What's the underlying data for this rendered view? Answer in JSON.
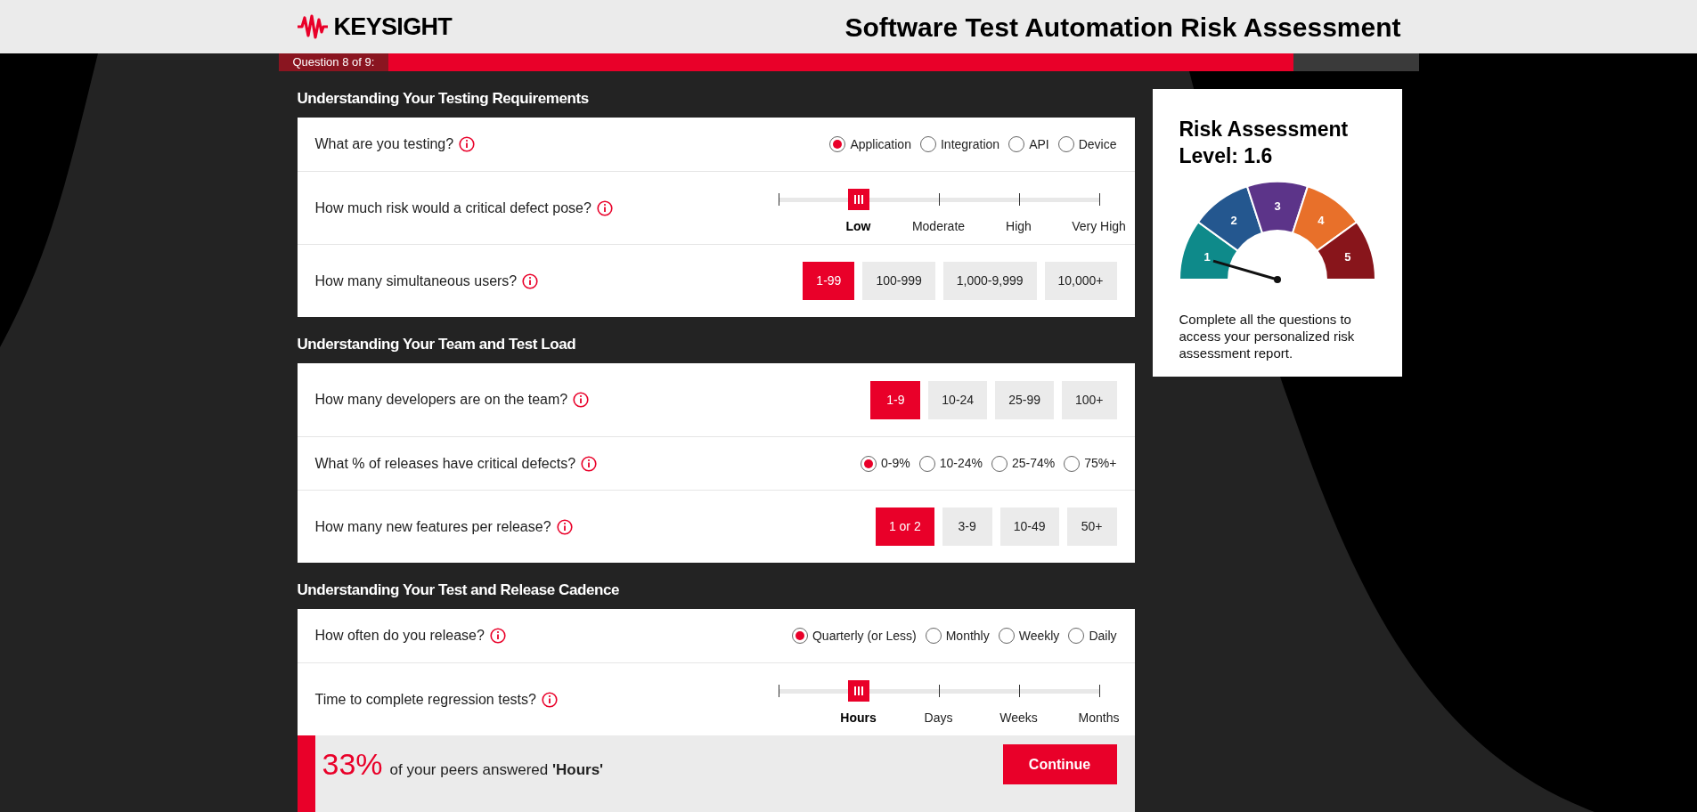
{
  "header": {
    "logo": "KEYSIGHT",
    "title": "Software Test Automation Risk Assessment"
  },
  "progress": {
    "label": "Question 8 of 9:",
    "level": 0.89
  },
  "sections": [
    {
      "title": "Understanding Your Testing Requirements",
      "questions": [
        {
          "kind": "radio",
          "text": "What are you testing?",
          "options": [
            {
              "label": "Application",
              "selected": true
            },
            {
              "label": "Integration",
              "selected": false
            },
            {
              "label": "API",
              "selected": false
            },
            {
              "label": "Device",
              "selected": false
            }
          ]
        },
        {
          "kind": "slider",
          "text": "How much risk would a critical defect pose?",
          "level": 0.25,
          "options": [
            {
              "label": "Low",
              "selected": true
            },
            {
              "label": "Moderate",
              "selected": false
            },
            {
              "label": "High",
              "selected": false
            },
            {
              "label": "Very High",
              "selected": false
            }
          ]
        },
        {
          "kind": "buttons",
          "text": "How many simultaneous users?",
          "options": [
            {
              "label": "1-99",
              "selected": true
            },
            {
              "label": "100-999",
              "selected": false
            },
            {
              "label": "1,000-9,999",
              "selected": false
            },
            {
              "label": "10,000+",
              "selected": false
            }
          ]
        }
      ]
    },
    {
      "title": "Understanding Your Team and Test Load",
      "questions": [
        {
          "kind": "buttons",
          "text": "How many developers are on the team?",
          "options": [
            {
              "label": "1-9",
              "selected": true
            },
            {
              "label": "10-24",
              "selected": false
            },
            {
              "label": "25-99",
              "selected": false
            },
            {
              "label": "100+",
              "selected": false
            }
          ]
        },
        {
          "kind": "radio",
          "text": "What % of releases have critical defects?",
          "options": [
            {
              "label": "0-9%",
              "selected": true
            },
            {
              "label": "10-24%",
              "selected": false
            },
            {
              "label": "25-74%",
              "selected": false
            },
            {
              "label": "75%+",
              "selected": false
            }
          ]
        },
        {
          "kind": "buttons",
          "text": "How many new features per release?",
          "options": [
            {
              "label": "1 or 2",
              "selected": true
            },
            {
              "label": "3-9",
              "selected": false
            },
            {
              "label": "10-49",
              "selected": false
            },
            {
              "label": "50+",
              "selected": false
            }
          ]
        }
      ]
    },
    {
      "title": "Understanding Your Test and Release Cadence",
      "questions": [
        {
          "kind": "radio",
          "text": "How often do you release?",
          "options": [
            {
              "label": "Quarterly (or Less)",
              "selected": true
            },
            {
              "label": "Monthly",
              "selected": false
            },
            {
              "label": "Weekly",
              "selected": false
            },
            {
              "label": "Daily",
              "selected": false
            }
          ]
        },
        {
          "kind": "slider",
          "text": "Time to complete regression tests?",
          "level": 0.25,
          "options": [
            {
              "label": "Hours",
              "selected": true
            },
            {
              "label": "Days",
              "selected": false
            },
            {
              "label": "Weeks",
              "selected": false
            },
            {
              "label": "Months",
              "selected": false
            }
          ]
        }
      ],
      "peer": {
        "percent": "33%",
        "text": "of your peers answered **'Hours'**",
        "button": "Continue"
      }
    }
  ],
  "risk_card": {
    "title": "Risk Assessment Level: 1.6",
    "segments": [
      {
        "label": "1",
        "color": "#0e8a8a"
      },
      {
        "label": "2",
        "color": "#24578f"
      },
      {
        "label": "3",
        "color": "#5c3489"
      },
      {
        "label": "4",
        "color": "#e8702a"
      },
      {
        "label": "5",
        "color": "#88151b"
      }
    ],
    "note": "Complete all the questions to access your personalized risk assessment report."
  }
}
